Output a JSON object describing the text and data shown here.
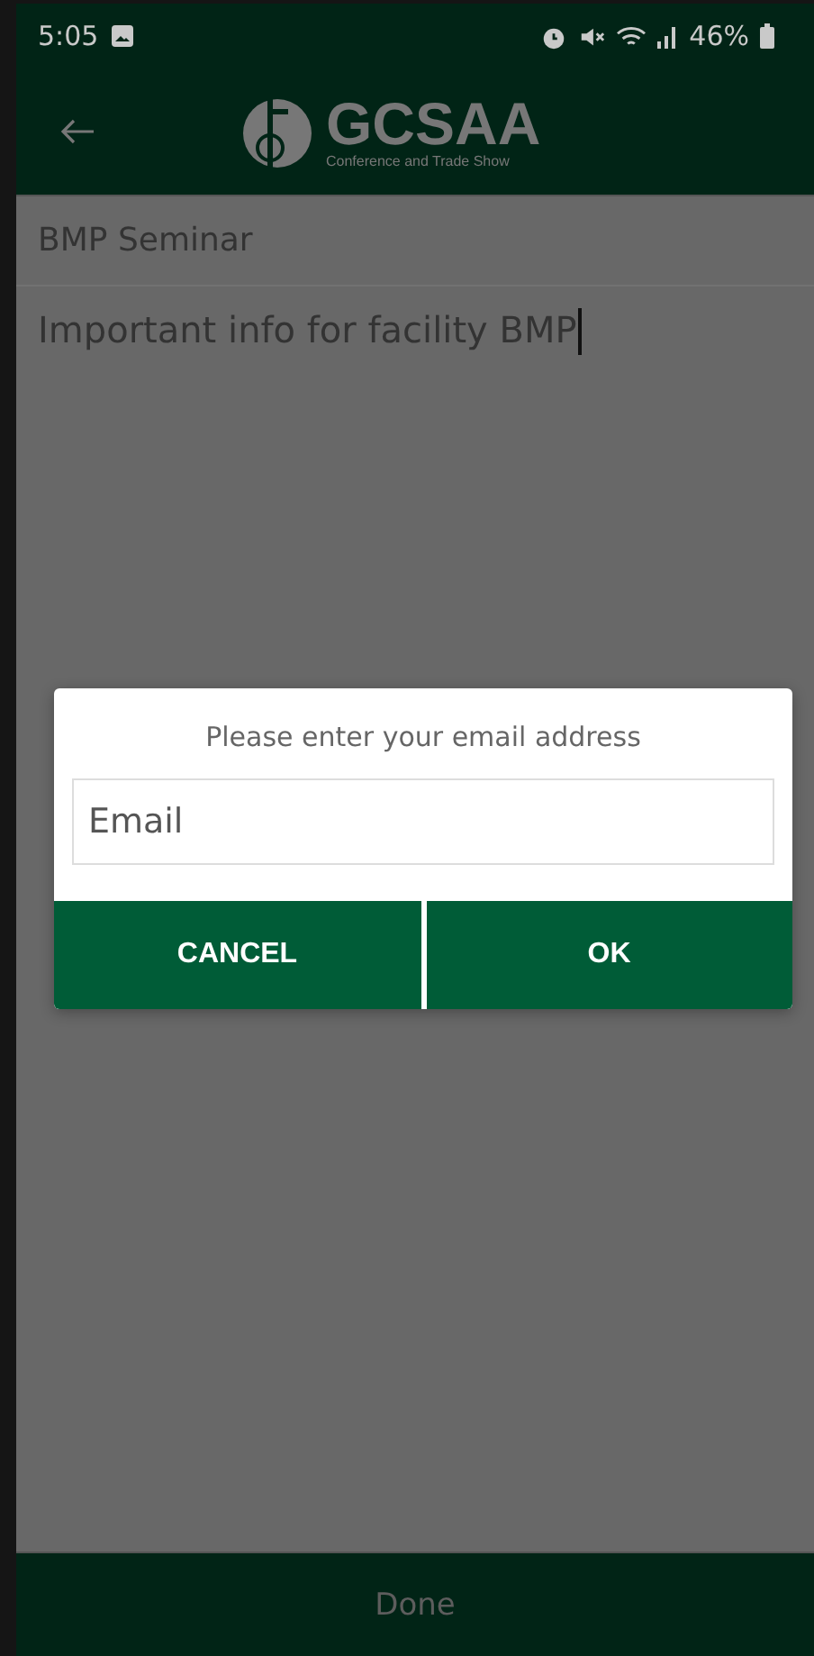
{
  "status_bar": {
    "time": "5:05",
    "battery": "46%"
  },
  "app_bar": {
    "logo_title": "GCSAA",
    "logo_subtitle": "Conference and Trade Show"
  },
  "note": {
    "title": "BMP Seminar",
    "body": "Important info for facility BMP"
  },
  "dialog": {
    "message": "Please enter your email address",
    "field": {
      "placeholder": "Email"
    },
    "buttons": [
      "CANCEL",
      "OK"
    ]
  },
  "footer": {
    "done": "Done"
  }
}
